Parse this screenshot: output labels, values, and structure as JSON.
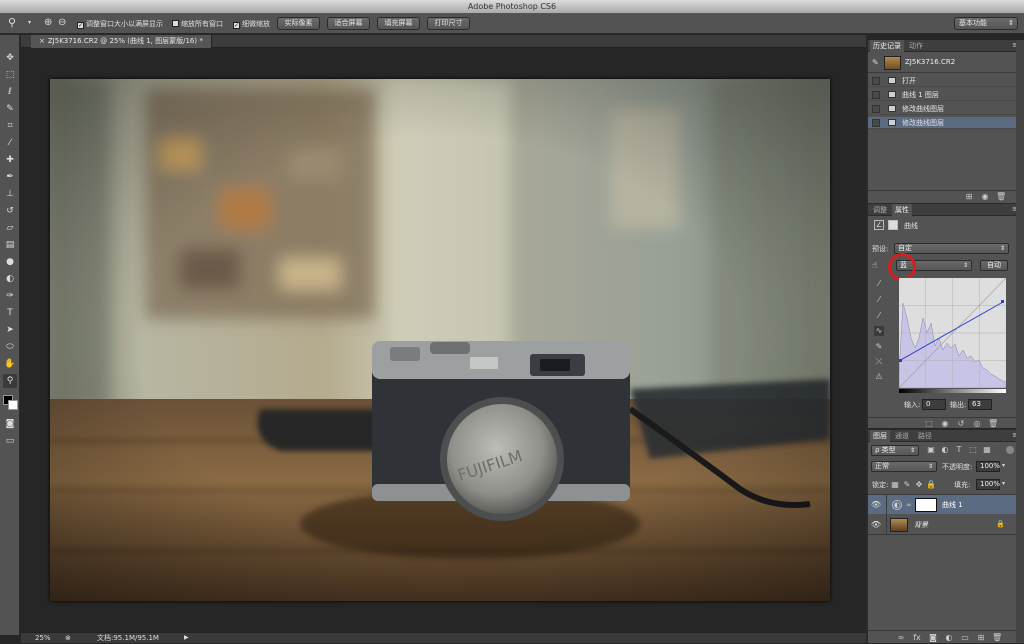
{
  "app": {
    "window_title": "Adobe Photoshop CS6"
  },
  "options_bar": {
    "resize_windows": "调整窗口大小以满屏显示",
    "zoom_all_windows": "缩放所有窗口",
    "scrubby_zoom": "细微缩放",
    "actual_pixels": "实际像素",
    "fit_screen": "适合屏幕",
    "fill_screen": "填充屏幕",
    "print_size": "打印尺寸",
    "workspace": "基本功能"
  },
  "document": {
    "tab_title": "ZJ5K3716.CR2 @ 25% (曲线 1, 图层蒙版/16) *"
  },
  "status": {
    "zoom": "25%",
    "doc_size": "文档:95.1M/95.1M"
  },
  "history_panel": {
    "tabs": [
      "历史记录",
      "动作"
    ],
    "snapshot": "ZJ5K3716.CR2",
    "items": [
      "打开",
      "曲线 1 图层",
      "修改曲线图层",
      "修改曲线图层"
    ]
  },
  "properties_panel": {
    "tabs": [
      "调整",
      "属性"
    ],
    "title": "曲线",
    "preset_label": "预设:",
    "preset_value": "自定",
    "channel_value": "蓝",
    "auto_button": "自动",
    "input_label": "输入:",
    "input_value": "0",
    "output_label": "输出:",
    "output_value": "63"
  },
  "layers_panel": {
    "tabs": [
      "图层",
      "通道",
      "路径"
    ],
    "filter_type": "ρ 类型",
    "blend_mode": "正常",
    "opacity_label": "不透明度:",
    "opacity_value": "100%",
    "lock_label": "锁定:",
    "fill_label": "填充:",
    "fill_value": "100%",
    "layers": [
      {
        "name": "曲线 1"
      },
      {
        "name": "背景"
      }
    ]
  },
  "colors": {
    "accent_selected": "#5b6b82",
    "highlight_circle": "#d41f1f",
    "curve_line": "#2a3fd0"
  }
}
